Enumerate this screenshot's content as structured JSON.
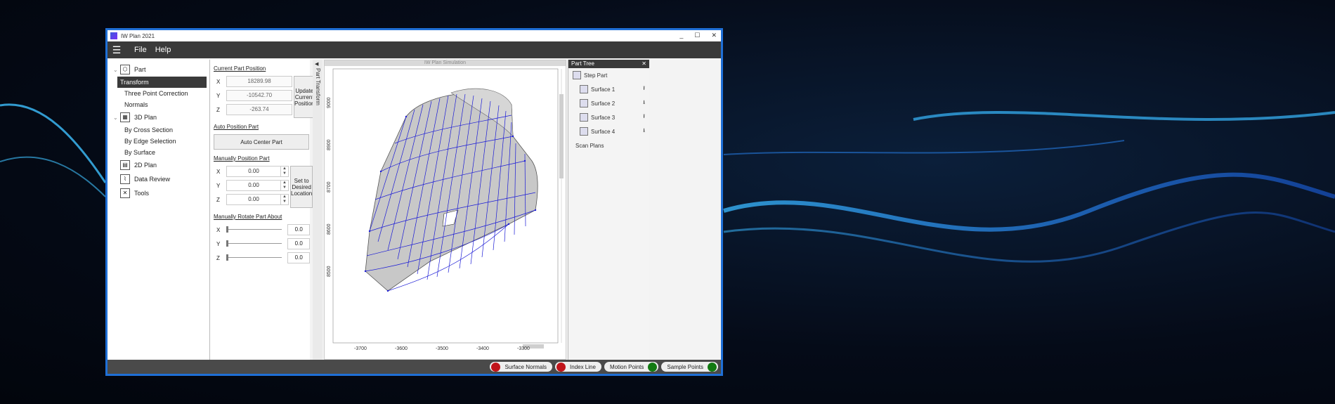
{
  "window": {
    "title": "IW Plan 2021",
    "controls": [
      "_",
      "☐",
      "✕"
    ]
  },
  "menu": {
    "items": [
      "File",
      "Help"
    ]
  },
  "nav": {
    "groups": [
      {
        "label": "Part",
        "icon": "cube-icon",
        "items": [
          "Transform",
          "Three Point Correction",
          "Normals"
        ]
      },
      {
        "label": "3D Plan",
        "icon": "grid-3d-icon",
        "items": [
          "By Cross Section",
          "By Edge Selection",
          "By Surface"
        ]
      },
      {
        "label": "2D Plan",
        "icon": "grid-2d-icon",
        "items": []
      },
      {
        "label": "Data Review",
        "icon": "chart-icon",
        "items": []
      },
      {
        "label": "Tools",
        "icon": "tools-icon",
        "items": []
      }
    ],
    "active": "Transform"
  },
  "transform": {
    "current_title": "Current Part Position",
    "current": {
      "x": "18289.98",
      "y": "-10542.70",
      "z": "-263.74"
    },
    "update_button": "Update Current Position",
    "auto_title": "Auto Position Part",
    "auto_button": "Auto Center Part",
    "manual_title": "Manually Position Part",
    "manual": {
      "x": "0.00",
      "y": "0.00",
      "z": "0.00"
    },
    "set_button": "Set to Desired Location",
    "rotate_title": "Manually Rotate Part About",
    "rotate": {
      "x": "0.0",
      "y": "0.0",
      "z": "0.0"
    },
    "labels": {
      "x": "X",
      "y": "Y",
      "z": "Z"
    }
  },
  "side_tab": {
    "label": "Part Transform"
  },
  "sim": {
    "title": "IW Plan Simulation",
    "x_ticks": [
      "-3700",
      "-3600",
      "-3500",
      "-3400",
      "-3300"
    ],
    "y_ticks": [
      "9000",
      "8900",
      "8700",
      "8600",
      "8500"
    ]
  },
  "tree": {
    "title": "Part Tree",
    "root": "Step Part",
    "surfaces": [
      "Surface 1",
      "Surface 2",
      "Surface 3",
      "Surface 4"
    ],
    "scan": "Scan Plans"
  },
  "status": {
    "toggles": [
      {
        "label": "Surface Normals",
        "color": "#c0141a"
      },
      {
        "label": "Index Line",
        "color": "#c0141a"
      },
      {
        "label": "Motion Points",
        "color": "#127a12"
      },
      {
        "label": "Sample Points",
        "color": "#127a12"
      }
    ]
  }
}
